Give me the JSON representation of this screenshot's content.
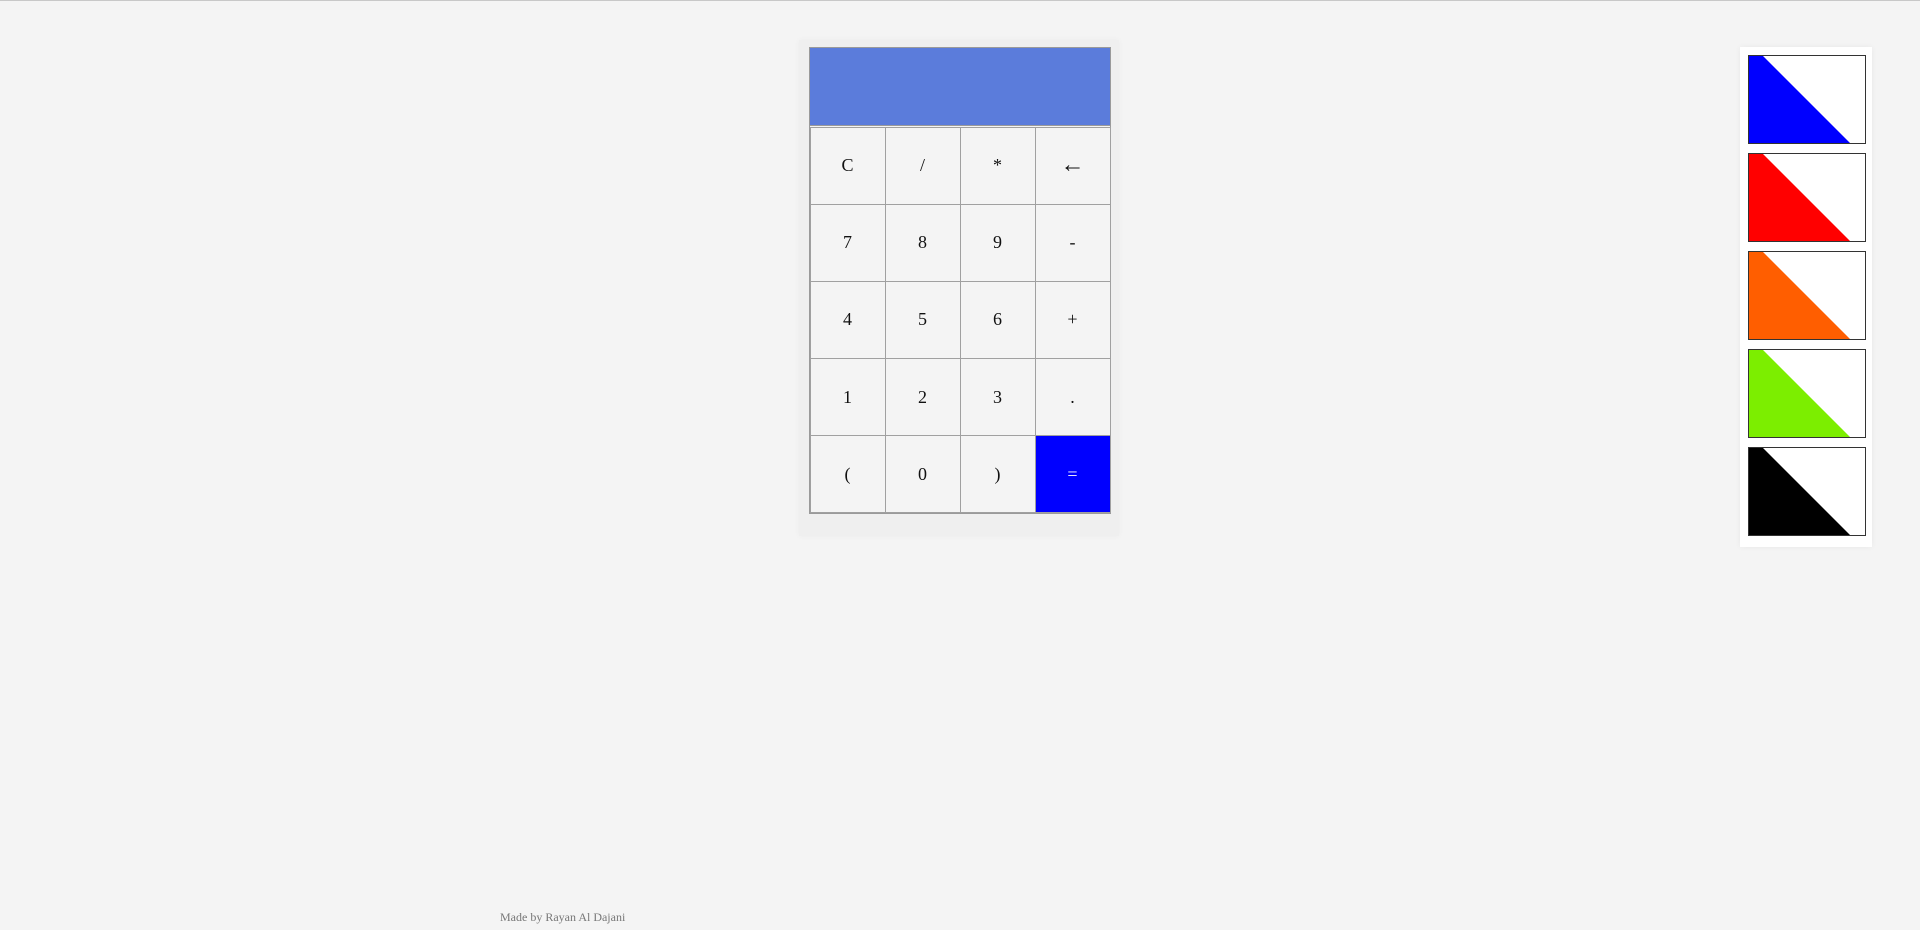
{
  "calculator": {
    "display_value": "",
    "colors": {
      "display_bg": "#5b7cdb",
      "equals_bg": "#0000ff"
    },
    "keys": [
      "C",
      "/",
      "*",
      "←",
      "7",
      "8",
      "9",
      "-",
      "4",
      "5",
      "6",
      "+",
      "1",
      "2",
      "3",
      ".",
      "(",
      "0",
      ")",
      "="
    ]
  },
  "themes": [
    {
      "name": "blue",
      "color": "#0000ff"
    },
    {
      "name": "red",
      "color": "#ff0000"
    },
    {
      "name": "orange",
      "color": "#ff5e00"
    },
    {
      "name": "green",
      "color": "#7cee00"
    },
    {
      "name": "black",
      "color": "#000000"
    }
  ],
  "footer": {
    "credit": "Made by Rayan Al Dajani"
  }
}
